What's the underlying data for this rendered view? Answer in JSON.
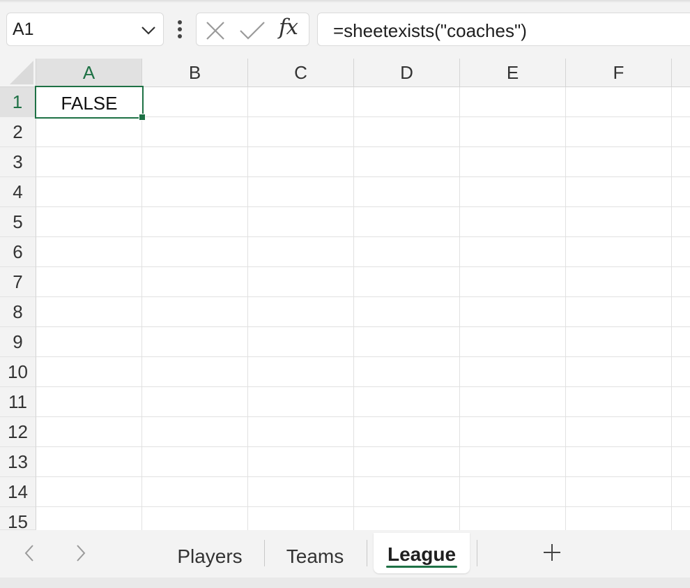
{
  "formula_bar": {
    "name_box": "A1",
    "fx_label": "fx",
    "formula": "=sheetexists(\"coaches\")"
  },
  "columns": [
    "A",
    "B",
    "C",
    "D",
    "E",
    "F"
  ],
  "rows": [
    "1",
    "2",
    "3",
    "4",
    "5",
    "6",
    "7",
    "8",
    "9",
    "10",
    "11",
    "12",
    "13",
    "14",
    "15"
  ],
  "selection": {
    "column": "A",
    "row": "1"
  },
  "cells": {
    "A1": "FALSE"
  },
  "sheet_tabs": {
    "tabs": [
      {
        "label": "Players",
        "active": false
      },
      {
        "label": "Teams",
        "active": false
      },
      {
        "label": "League",
        "active": true
      }
    ]
  },
  "colors": {
    "accent": "#1e7145",
    "header_bg": "#f3f3f3",
    "gridline": "#e1e1e1"
  },
  "icons": [
    "chevron-down-icon",
    "more-vertical-icon",
    "cancel-icon",
    "enter-check-icon",
    "fx-icon",
    "chevron-left-icon",
    "chevron-right-icon",
    "plus-icon"
  ]
}
